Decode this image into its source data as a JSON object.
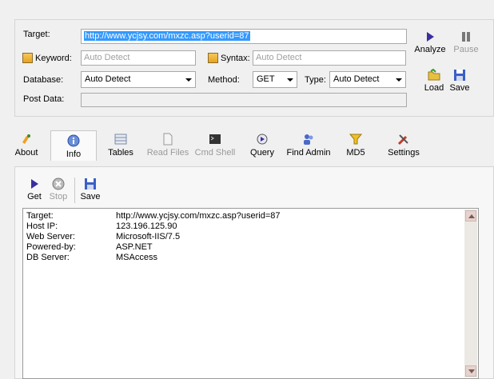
{
  "form": {
    "target_label": "Target:",
    "target_value": "http://www.ycjsy.com/mxzc.asp?userid=87",
    "keyword_label": "Keyword:",
    "keyword_placeholder": "Auto Detect",
    "syntax_label": "Syntax:",
    "syntax_placeholder": "Auto Detect",
    "database_label": "Database:",
    "database_value": "Auto Detect",
    "method_label": "Method:",
    "method_value": "GET",
    "type_label": "Type:",
    "type_value": "Auto Detect",
    "postdata_label": "Post Data:"
  },
  "actions": {
    "analyze": "Analyze",
    "pause": "Pause",
    "load": "Load",
    "save": "Save"
  },
  "tabs": [
    {
      "label": "About",
      "icon": "about-icon"
    },
    {
      "label": "Info",
      "icon": "info-icon"
    },
    {
      "label": "Tables",
      "icon": "tables-icon"
    },
    {
      "label": "Read Files",
      "icon": "file-icon"
    },
    {
      "label": "Cmd Shell",
      "icon": "terminal-icon"
    },
    {
      "label": "Query",
      "icon": "query-icon"
    },
    {
      "label": "Find Admin",
      "icon": "users-icon"
    },
    {
      "label": "MD5",
      "icon": "funnel-icon"
    },
    {
      "label": "Settings",
      "icon": "tools-icon"
    }
  ],
  "info_toolbar": {
    "get": "Get",
    "stop": "Stop",
    "save": "Save"
  },
  "output": [
    {
      "key": "Target:",
      "value": "http://www.ycjsy.com/mxzc.asp?userid=87"
    },
    {
      "key": "Host IP:",
      "value": "123.196.125.90"
    },
    {
      "key": "Web Server:",
      "value": "Microsoft-IIS/7.5"
    },
    {
      "key": "Powered-by:",
      "value": "ASP.NET"
    },
    {
      "key": "DB Server:",
      "value": "MSAccess"
    }
  ],
  "colors": {
    "selection": "#3399ff",
    "play": "#3a2fa0",
    "checkbox": "#f0b030"
  }
}
